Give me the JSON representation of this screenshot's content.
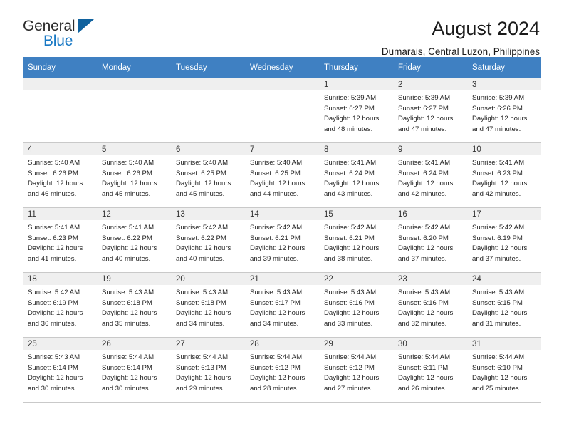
{
  "logo": {
    "primary_text": "General",
    "secondary_text": "Blue",
    "icon": "triangle-icon",
    "primary_color": "#2b2b2b",
    "secondary_color": "#1878c4",
    "triangle_color": "#10629e"
  },
  "header": {
    "title": "August 2024",
    "location": "Dumarais, Central Luzon, Philippines"
  },
  "calendar": {
    "header_color": "#3f80c2",
    "daynum_bg": "#efefef",
    "weekdays": [
      "Sunday",
      "Monday",
      "Tuesday",
      "Wednesday",
      "Thursday",
      "Friday",
      "Saturday"
    ],
    "weeks": [
      [
        {
          "empty": true
        },
        {
          "empty": true
        },
        {
          "empty": true
        },
        {
          "empty": true
        },
        {
          "day": "1",
          "sunrise": "Sunrise: 5:39 AM",
          "sunset": "Sunset: 6:27 PM",
          "daylight_line1": "Daylight: 12 hours",
          "daylight_line2": "and 48 minutes."
        },
        {
          "day": "2",
          "sunrise": "Sunrise: 5:39 AM",
          "sunset": "Sunset: 6:27 PM",
          "daylight_line1": "Daylight: 12 hours",
          "daylight_line2": "and 47 minutes."
        },
        {
          "day": "3",
          "sunrise": "Sunrise: 5:39 AM",
          "sunset": "Sunset: 6:26 PM",
          "daylight_line1": "Daylight: 12 hours",
          "daylight_line2": "and 47 minutes."
        }
      ],
      [
        {
          "day": "4",
          "sunrise": "Sunrise: 5:40 AM",
          "sunset": "Sunset: 6:26 PM",
          "daylight_line1": "Daylight: 12 hours",
          "daylight_line2": "and 46 minutes."
        },
        {
          "day": "5",
          "sunrise": "Sunrise: 5:40 AM",
          "sunset": "Sunset: 6:26 PM",
          "daylight_line1": "Daylight: 12 hours",
          "daylight_line2": "and 45 minutes."
        },
        {
          "day": "6",
          "sunrise": "Sunrise: 5:40 AM",
          "sunset": "Sunset: 6:25 PM",
          "daylight_line1": "Daylight: 12 hours",
          "daylight_line2": "and 45 minutes."
        },
        {
          "day": "7",
          "sunrise": "Sunrise: 5:40 AM",
          "sunset": "Sunset: 6:25 PM",
          "daylight_line1": "Daylight: 12 hours",
          "daylight_line2": "and 44 minutes."
        },
        {
          "day": "8",
          "sunrise": "Sunrise: 5:41 AM",
          "sunset": "Sunset: 6:24 PM",
          "daylight_line1": "Daylight: 12 hours",
          "daylight_line2": "and 43 minutes."
        },
        {
          "day": "9",
          "sunrise": "Sunrise: 5:41 AM",
          "sunset": "Sunset: 6:24 PM",
          "daylight_line1": "Daylight: 12 hours",
          "daylight_line2": "and 42 minutes."
        },
        {
          "day": "10",
          "sunrise": "Sunrise: 5:41 AM",
          "sunset": "Sunset: 6:23 PM",
          "daylight_line1": "Daylight: 12 hours",
          "daylight_line2": "and 42 minutes."
        }
      ],
      [
        {
          "day": "11",
          "sunrise": "Sunrise: 5:41 AM",
          "sunset": "Sunset: 6:23 PM",
          "daylight_line1": "Daylight: 12 hours",
          "daylight_line2": "and 41 minutes."
        },
        {
          "day": "12",
          "sunrise": "Sunrise: 5:41 AM",
          "sunset": "Sunset: 6:22 PM",
          "daylight_line1": "Daylight: 12 hours",
          "daylight_line2": "and 40 minutes."
        },
        {
          "day": "13",
          "sunrise": "Sunrise: 5:42 AM",
          "sunset": "Sunset: 6:22 PM",
          "daylight_line1": "Daylight: 12 hours",
          "daylight_line2": "and 40 minutes."
        },
        {
          "day": "14",
          "sunrise": "Sunrise: 5:42 AM",
          "sunset": "Sunset: 6:21 PM",
          "daylight_line1": "Daylight: 12 hours",
          "daylight_line2": "and 39 minutes."
        },
        {
          "day": "15",
          "sunrise": "Sunrise: 5:42 AM",
          "sunset": "Sunset: 6:21 PM",
          "daylight_line1": "Daylight: 12 hours",
          "daylight_line2": "and 38 minutes."
        },
        {
          "day": "16",
          "sunrise": "Sunrise: 5:42 AM",
          "sunset": "Sunset: 6:20 PM",
          "daylight_line1": "Daylight: 12 hours",
          "daylight_line2": "and 37 minutes."
        },
        {
          "day": "17",
          "sunrise": "Sunrise: 5:42 AM",
          "sunset": "Sunset: 6:19 PM",
          "daylight_line1": "Daylight: 12 hours",
          "daylight_line2": "and 37 minutes."
        }
      ],
      [
        {
          "day": "18",
          "sunrise": "Sunrise: 5:42 AM",
          "sunset": "Sunset: 6:19 PM",
          "daylight_line1": "Daylight: 12 hours",
          "daylight_line2": "and 36 minutes."
        },
        {
          "day": "19",
          "sunrise": "Sunrise: 5:43 AM",
          "sunset": "Sunset: 6:18 PM",
          "daylight_line1": "Daylight: 12 hours",
          "daylight_line2": "and 35 minutes."
        },
        {
          "day": "20",
          "sunrise": "Sunrise: 5:43 AM",
          "sunset": "Sunset: 6:18 PM",
          "daylight_line1": "Daylight: 12 hours",
          "daylight_line2": "and 34 minutes."
        },
        {
          "day": "21",
          "sunrise": "Sunrise: 5:43 AM",
          "sunset": "Sunset: 6:17 PM",
          "daylight_line1": "Daylight: 12 hours",
          "daylight_line2": "and 34 minutes."
        },
        {
          "day": "22",
          "sunrise": "Sunrise: 5:43 AM",
          "sunset": "Sunset: 6:16 PM",
          "daylight_line1": "Daylight: 12 hours",
          "daylight_line2": "and 33 minutes."
        },
        {
          "day": "23",
          "sunrise": "Sunrise: 5:43 AM",
          "sunset": "Sunset: 6:16 PM",
          "daylight_line1": "Daylight: 12 hours",
          "daylight_line2": "and 32 minutes."
        },
        {
          "day": "24",
          "sunrise": "Sunrise: 5:43 AM",
          "sunset": "Sunset: 6:15 PM",
          "daylight_line1": "Daylight: 12 hours",
          "daylight_line2": "and 31 minutes."
        }
      ],
      [
        {
          "day": "25",
          "sunrise": "Sunrise: 5:43 AM",
          "sunset": "Sunset: 6:14 PM",
          "daylight_line1": "Daylight: 12 hours",
          "daylight_line2": "and 30 minutes."
        },
        {
          "day": "26",
          "sunrise": "Sunrise: 5:44 AM",
          "sunset": "Sunset: 6:14 PM",
          "daylight_line1": "Daylight: 12 hours",
          "daylight_line2": "and 30 minutes."
        },
        {
          "day": "27",
          "sunrise": "Sunrise: 5:44 AM",
          "sunset": "Sunset: 6:13 PM",
          "daylight_line1": "Daylight: 12 hours",
          "daylight_line2": "and 29 minutes."
        },
        {
          "day": "28",
          "sunrise": "Sunrise: 5:44 AM",
          "sunset": "Sunset: 6:12 PM",
          "daylight_line1": "Daylight: 12 hours",
          "daylight_line2": "and 28 minutes."
        },
        {
          "day": "29",
          "sunrise": "Sunrise: 5:44 AM",
          "sunset": "Sunset: 6:12 PM",
          "daylight_line1": "Daylight: 12 hours",
          "daylight_line2": "and 27 minutes."
        },
        {
          "day": "30",
          "sunrise": "Sunrise: 5:44 AM",
          "sunset": "Sunset: 6:11 PM",
          "daylight_line1": "Daylight: 12 hours",
          "daylight_line2": "and 26 minutes."
        },
        {
          "day": "31",
          "sunrise": "Sunrise: 5:44 AM",
          "sunset": "Sunset: 6:10 PM",
          "daylight_line1": "Daylight: 12 hours",
          "daylight_line2": "and 25 minutes."
        }
      ]
    ]
  }
}
